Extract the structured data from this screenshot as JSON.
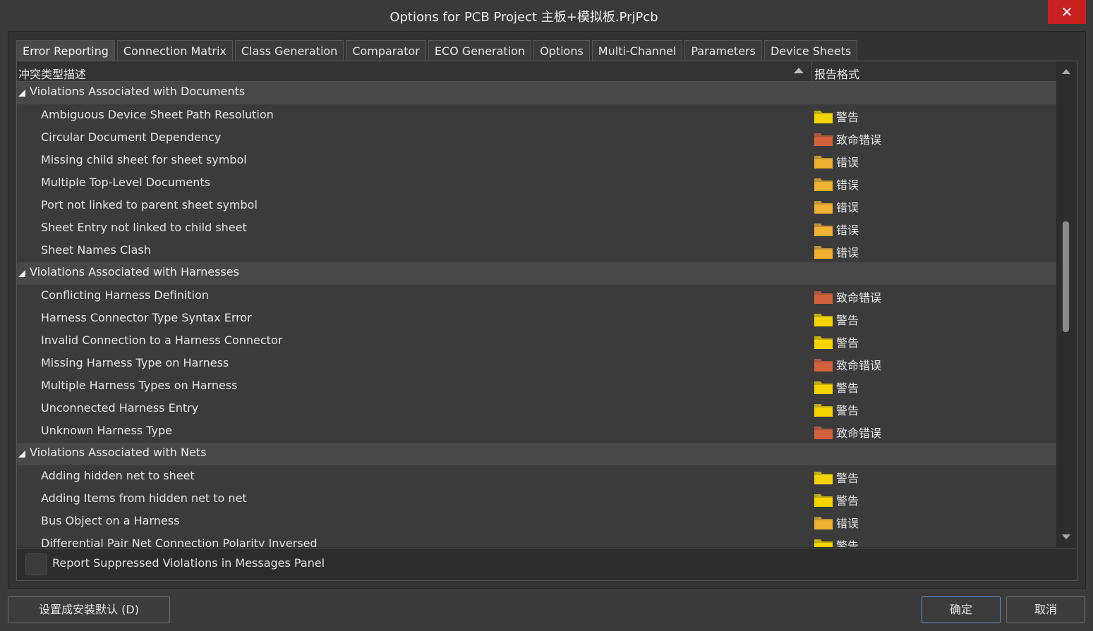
{
  "window": {
    "title": "Options for PCB Project 主板+模拟板.PrjPcb",
    "close_glyph": "✕"
  },
  "tabs": [
    "Error Reporting",
    "Connection Matrix",
    "Class Generation",
    "Comparator",
    "ECO Generation",
    "Options",
    "Multi-Channel",
    "Parameters",
    "Device Sheets"
  ],
  "active_tab": "Error Reporting",
  "table": {
    "col1_header": "冲突类型描述",
    "col2_header": "报告格式",
    "sorted_column": "col1",
    "groups": [
      {
        "label": "Violations Associated with Documents",
        "items": [
          {
            "name": "Ambiguous Device Sheet Path Resolution",
            "level": "警告"
          },
          {
            "name": "Circular Document Dependency",
            "level": "致命错误"
          },
          {
            "name": "Missing child sheet for sheet symbol",
            "level": "错误"
          },
          {
            "name": "Multiple Top-Level Documents",
            "level": "错误"
          },
          {
            "name": "Port not linked to parent sheet symbol",
            "level": "错误"
          },
          {
            "name": "Sheet Entry not linked to child sheet",
            "level": "错误"
          },
          {
            "name": "Sheet Names Clash",
            "level": "错误"
          }
        ]
      },
      {
        "label": "Violations Associated with Harnesses",
        "items": [
          {
            "name": "Conflicting Harness Definition",
            "level": "致命错误"
          },
          {
            "name": "Harness Connector Type Syntax Error",
            "level": "警告"
          },
          {
            "name": "Invalid Connection to a Harness Connector",
            "level": "警告"
          },
          {
            "name": "Missing Harness Type on Harness",
            "level": "致命错误"
          },
          {
            "name": "Multiple Harness Types on Harness",
            "level": "警告"
          },
          {
            "name": "Unconnected Harness Entry",
            "level": "警告"
          },
          {
            "name": "Unknown Harness Type",
            "level": "致命错误"
          }
        ]
      },
      {
        "label": "Violations Associated with Nets",
        "items": [
          {
            "name": "Adding hidden net to sheet",
            "level": "警告"
          },
          {
            "name": "Adding Items from hidden net to net",
            "level": "警告"
          },
          {
            "name": "Bus Object on a Harness",
            "level": "错误"
          },
          {
            "name": "Differential Pair Net Connection Polarity Inversed",
            "level": "警告"
          }
        ]
      }
    ]
  },
  "level_colors": {
    "警告": "#f5d400",
    "错误": "#f0b230",
    "致命错误": "#d4613d"
  },
  "report_suppressed": {
    "label": "Report Suppressed Violations in Messages Panel",
    "checked": false
  },
  "buttons": {
    "set_default": "设置成安装默认 (D)",
    "ok": "确定",
    "cancel": "取消"
  }
}
